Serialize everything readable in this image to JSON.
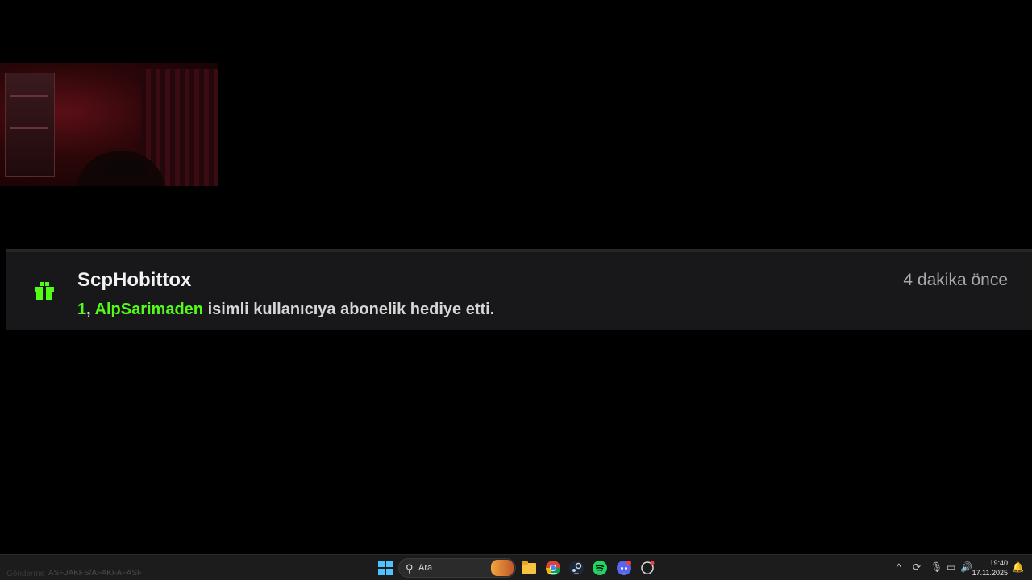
{
  "notification": {
    "username": "ScpHobittox",
    "time": "4 dakika önce",
    "count": "1",
    "separator": ",",
    "recipient": "AlpSarimaden",
    "message": "isimli kullanıcıya abonelik hediye etti.",
    "gift_icon": "gift-icon",
    "accent_color": "#53fc18"
  },
  "taskbar": {
    "watermark": "Gönderme",
    "watermark2": "ASFJAKFS/AFAKFAFASF",
    "search_placeholder": "Ara",
    "apps": [
      "windows-start-icon",
      "file-explorer-icon",
      "chrome-icon",
      "steam-icon",
      "spotify-icon",
      "discord-icon",
      "app-icon"
    ],
    "clock_time": "19:40",
    "clock_date": "17.11.2025"
  }
}
